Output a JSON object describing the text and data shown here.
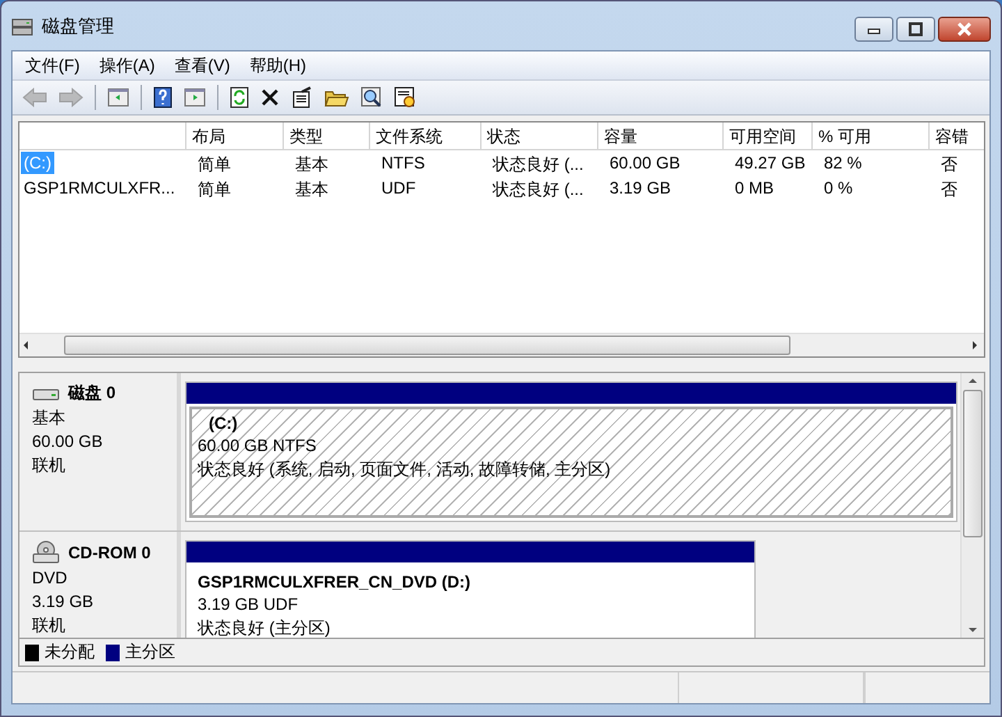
{
  "window": {
    "title": "磁盘管理"
  },
  "menu": [
    "文件(F)",
    "操作(A)",
    "查看(V)",
    "帮助(H)"
  ],
  "toolbar": [
    [
      {
        "kind": "back",
        "disabled": true
      },
      {
        "kind": "forward",
        "disabled": true
      }
    ],
    [
      {
        "kind": "panel-left",
        "disabled": false
      }
    ],
    [
      {
        "kind": "help",
        "disabled": false
      },
      {
        "kind": "panel-right",
        "disabled": false
      }
    ],
    [
      {
        "kind": "refresh",
        "disabled": false
      },
      {
        "kind": "delete",
        "disabled": false
      },
      {
        "kind": "properties",
        "disabled": false
      },
      {
        "kind": "open",
        "disabled": false
      },
      {
        "kind": "explore",
        "disabled": false
      },
      {
        "kind": "settings",
        "disabled": false
      }
    ]
  ],
  "table": {
    "columns": [
      "",
      "布局",
      "类型",
      "文件系统",
      "状态",
      "容量",
      "可用空间",
      "% 可用",
      "容错"
    ],
    "rows": [
      {
        "selected": true,
        "cells": [
          "(C:)",
          "简单",
          "基本",
          "NTFS",
          "状态良好 (...",
          "60.00 GB",
          "49.27 GB",
          "82 %",
          "否"
        ]
      },
      {
        "selected": false,
        "cells": [
          "GSP1RMCULXFR...",
          "简单",
          "基本",
          "UDF",
          "状态良好 (...",
          "3.19 GB",
          "0 MB",
          "0 %",
          "否"
        ]
      }
    ]
  },
  "disks": [
    {
      "kind": "disk",
      "name": "磁盘 0",
      "type": "基本",
      "size": "60.00 GB",
      "state": "联机",
      "partition": {
        "name": "(C:)",
        "size_fs": "60.00 GB NTFS",
        "status": "状态良好 (系统, 启动, 页面文件, 活动, 故障转储, 主分区)",
        "selected": true
      }
    },
    {
      "kind": "cdrom",
      "name": "CD-ROM 0",
      "type": "DVD",
      "size": "3.19 GB",
      "state": "联机",
      "partition": {
        "name": "GSP1RMCULXFRER_CN_DVD  (D:)",
        "size_fs": "3.19 GB UDF",
        "status": "状态良好 (主分区)",
        "selected": false
      }
    }
  ],
  "legend": [
    {
      "label": "未分配",
      "color": "#000000"
    },
    {
      "label": "主分区",
      "color": "#000080"
    }
  ]
}
